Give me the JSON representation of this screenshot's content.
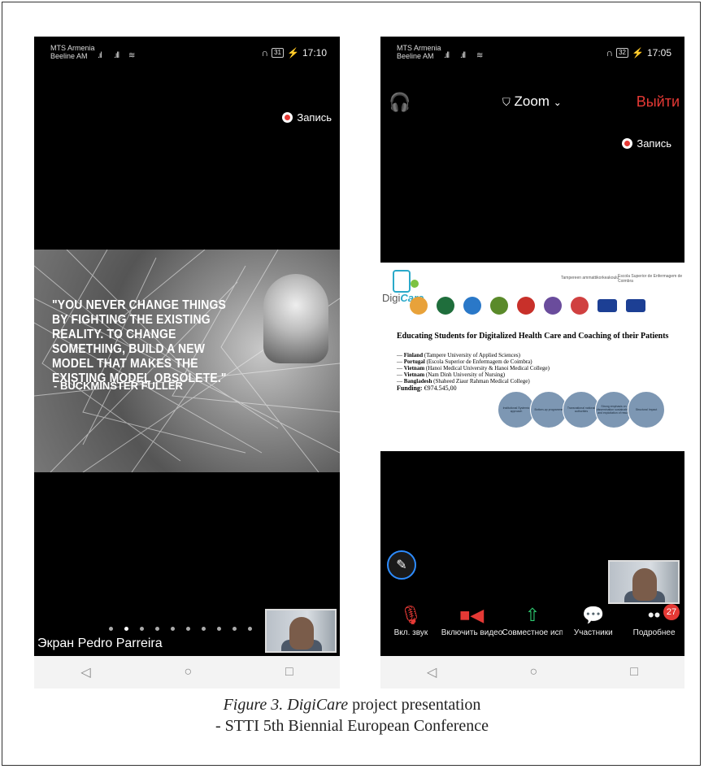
{
  "phone_left": {
    "carrier": [
      "MTS Armenia",
      "Beeline AM"
    ],
    "time": "17:10",
    "battery": "31",
    "recording_label": "Запись",
    "quote": "\"YOU NEVER CHANGE THINGS BY FIGHTING THE EXISTING REALITY. TO CHANGE SOMETHING, BUILD A NEW MODEL THAT MAKES THE EXISTING MODEL OBSOLETE.\"",
    "quote_author": "- BUCKMINSTER FULLER",
    "screen_label": "Экран Pedro Parreira",
    "page_dots": 10,
    "active_dot": 1
  },
  "phone_right": {
    "carrier": [
      "MTS Armenia",
      "Beeline AM"
    ],
    "time": "17:05",
    "battery": "32",
    "app_title": "Zoom",
    "leave_label": "Выйти",
    "recording_label": "Запись",
    "slide": {
      "logo_text_1": "Digi",
      "logo_text_2": "Care",
      "tamk": "Tampereen ammattikorkeakoulu",
      "coimbra": "Escola Superior de Enfermagem de Coimbra",
      "title": "Educating Students for Digitalized Health Care and Coaching of their Patients",
      "partners": [
        {
          "country": "Finland",
          "institution": "(Tampere University of Applied Sciences)"
        },
        {
          "country": "Portugal",
          "institution": "(Escola Superior de Enfermagem de Coimbra)"
        },
        {
          "country": "Vietnam",
          "institution": "(Hanoi Medical University & Hanoi Medical College)"
        },
        {
          "country": "Vietnam",
          "institution": "(Nam Dinh University of Nursing)"
        },
        {
          "country": "Bangladesh",
          "institution": "(Shaheed Ziaur Rahman Medical College)"
        }
      ],
      "funding_label": "Funding:",
      "funding_value": "€974.545,00",
      "circles": [
        "Institutional Systemic approach",
        "Bottom-up programme",
        "Transnational national authorities",
        "Strong emphasis on dissemination sustainability and exploitation of results",
        "Structural Impact"
      ]
    },
    "toolbar": [
      {
        "label": "Вкл. звук",
        "icon": "mic-muted-icon",
        "color": "#e53935"
      },
      {
        "label": "Включить видео",
        "icon": "video-off-icon",
        "color": "#e53935"
      },
      {
        "label": "Совместное использование",
        "icon": "share-icon",
        "color": "#2ecc71"
      },
      {
        "label": "Участники",
        "icon": "chat-icon",
        "color": "#ffffff"
      },
      {
        "label": "Подробнее",
        "icon": "more-icon",
        "color": "#ffffff",
        "badge": "27"
      }
    ]
  },
  "caption": {
    "line1_italic": "Figure 3. DigiCare",
    "line1_rest": " project presentation",
    "line2": "- STTI 5th Biennial European Conference"
  }
}
